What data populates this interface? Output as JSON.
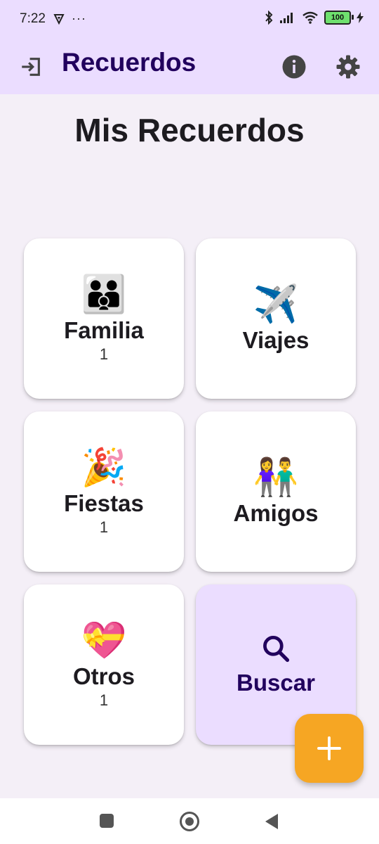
{
  "status_bar": {
    "time": "7:22",
    "more": "···",
    "battery": "100"
  },
  "app_bar": {
    "title": "Recuerdos"
  },
  "main": {
    "title": "Mis Recuerdos",
    "categories": [
      {
        "emoji": "👪",
        "label": "Familia",
        "count": "1"
      },
      {
        "emoji": "✈️",
        "label": "Viajes",
        "count": ""
      },
      {
        "emoji": "🎉",
        "label": "Fiestas",
        "count": "1"
      },
      {
        "emoji": "👫",
        "label": "Amigos",
        "count": ""
      },
      {
        "emoji": "💝",
        "label": "Otros",
        "count": "1"
      }
    ],
    "search_label": "Buscar"
  },
  "colors": {
    "app_bar_bg": "#EBDDFF",
    "title_color": "#21005D",
    "fab": "#F6A623",
    "background": "#F4EFF7"
  },
  "icons": {
    "logout": "logout-icon",
    "info": "info-icon",
    "settings": "settings-icon",
    "search": "search-icon",
    "add": "add-icon"
  }
}
